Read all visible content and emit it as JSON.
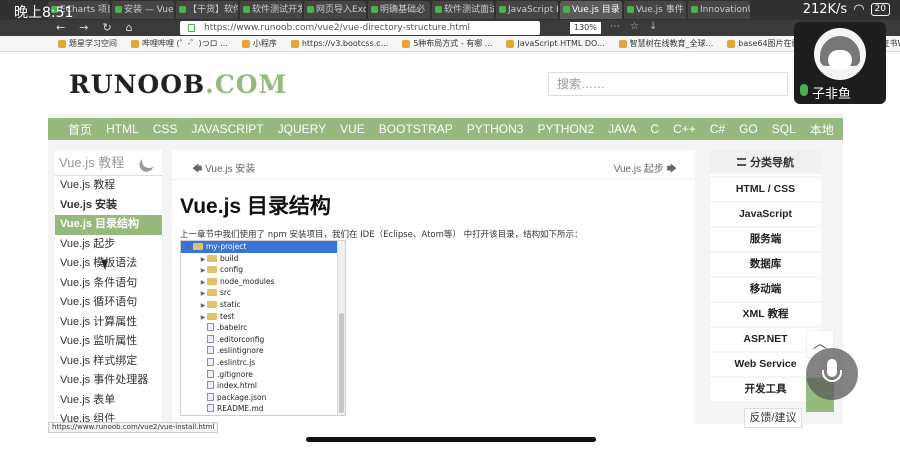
{
  "phone": {
    "time": "晚上8:51",
    "network": "212K/s",
    "battery": "20"
  },
  "browser": {
    "tabs": [
      "ECharts 项目",
      "安装 — Vue.js",
      "【干货】软件",
      "软件测试开发",
      "网页导入Exce",
      "明确基础必",
      "软件测试面试",
      "JavaScript H",
      "Vue.js 目录",
      "Vue.js 事件",
      "InnovationU"
    ],
    "active_tab_index": 8,
    "url": "https://www.runoob.com/vue2/vue-directory-structure.html",
    "zoom": "130%",
    "bookmarks": [
      "题星学习空间",
      "哔哩哔哩 (゜-゜)つロ ...",
      "小程序",
      "https://v3.bootcss.c...",
      "5种布局方式 - 有哪 ...",
      "JavaScript HTML DO...",
      "智慧树在线教育_全球...",
      "base64图片在线转换...",
      "1+X中级证书Web前..."
    ]
  },
  "site": {
    "logo_main": "RUNOOB",
    "logo_suffix": ".COM",
    "search_placeholder": "搜索……",
    "nav": [
      "首页",
      "HTML",
      "CSS",
      "JAVASCRIPT",
      "JQUERY",
      "VUE",
      "BOOTSTRAP",
      "PYTHON3",
      "PYTHON2",
      "JAVA",
      "C",
      "C++",
      "C#",
      "GO",
      "SQL",
      "本地"
    ]
  },
  "sidebar": {
    "title": "Vue.js 教程",
    "items": [
      {
        "label": "Vue.js 教程",
        "state": "normal"
      },
      {
        "label": "Vue.js 安装",
        "state": "bold"
      },
      {
        "label": "Vue.js 目录结构",
        "state": "active"
      },
      {
        "label": "Vue.js 起步",
        "state": "normal"
      },
      {
        "label": "Vue.js 模板语法",
        "state": "normal"
      },
      {
        "label": "Vue.js 条件语句",
        "state": "normal"
      },
      {
        "label": "Vue.js 循环语句",
        "state": "normal"
      },
      {
        "label": "Vue.js 计算属性",
        "state": "normal"
      },
      {
        "label": "Vue.js 监听属性",
        "state": "normal"
      },
      {
        "label": "Vue.js 样式绑定",
        "state": "normal"
      },
      {
        "label": "Vue.js 事件处理器",
        "state": "normal"
      },
      {
        "label": "Vue.js 表单",
        "state": "normal"
      },
      {
        "label": "Vue.js 组件",
        "state": "normal"
      }
    ]
  },
  "article": {
    "prev": "Vue.js 安装",
    "next": "Vue.js 起步",
    "title": "Vue.js 目录结构",
    "intro": "上一章节中我们使用了 npm 安装项目，我们在 IDE（Eclipse、Atom等） 中打开该目录，结构如下所示：",
    "tree": [
      {
        "name": "my-project",
        "kind": "folder",
        "level": 0,
        "open": true,
        "selected": true
      },
      {
        "name": "build",
        "kind": "folder",
        "level": 1,
        "open": false,
        "selected": false
      },
      {
        "name": "config",
        "kind": "folder",
        "level": 1,
        "open": false,
        "selected": false
      },
      {
        "name": "node_modules",
        "kind": "folder",
        "level": 1,
        "open": false,
        "selected": false
      },
      {
        "name": "src",
        "kind": "folder",
        "level": 1,
        "open": false,
        "selected": false
      },
      {
        "name": "static",
        "kind": "folder",
        "level": 1,
        "open": false,
        "selected": false
      },
      {
        "name": "test",
        "kind": "folder",
        "level": 1,
        "open": false,
        "selected": false
      },
      {
        "name": ".babelrc",
        "kind": "file",
        "level": 1,
        "selected": false
      },
      {
        "name": ".editorconfig",
        "kind": "file",
        "level": 1,
        "selected": false
      },
      {
        "name": ".eslintignore",
        "kind": "file",
        "level": 1,
        "selected": false
      },
      {
        "name": ".eslintrc.js",
        "kind": "file",
        "level": 1,
        "selected": false
      },
      {
        "name": ".gitignore",
        "kind": "file",
        "level": 1,
        "selected": false
      },
      {
        "name": "index.html",
        "kind": "file",
        "level": 1,
        "selected": false
      },
      {
        "name": "package.json",
        "kind": "file",
        "level": 1,
        "selected": false
      },
      {
        "name": "README.md",
        "kind": "file",
        "level": 1,
        "selected": false
      }
    ]
  },
  "rightbar": {
    "title": "分类导航",
    "items": [
      "HTML / CSS",
      "JavaScript",
      "服务端",
      "数据库",
      "移动端",
      "XML 教程",
      "ASP.NET",
      "Web Service",
      "开发工具"
    ]
  },
  "overlay": {
    "status_url": "https://www.runoob.com/vue2/vue-install.html",
    "streamer_name": "子非鱼",
    "feedback": "反馈/建议"
  },
  "colors": {
    "brand": "#96b97d",
    "selected_tree": "#3875d7"
  }
}
